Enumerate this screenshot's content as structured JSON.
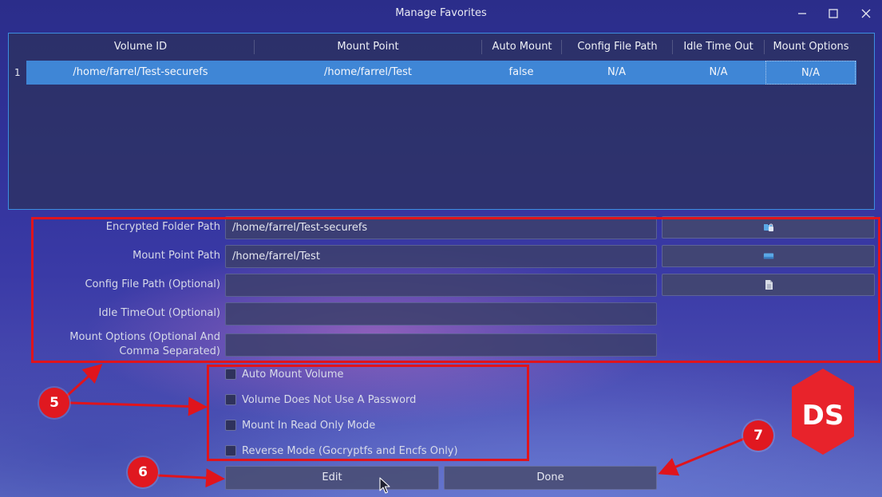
{
  "window": {
    "title": "Manage Favorites"
  },
  "table": {
    "headers": [
      "Volume ID",
      "Mount Point",
      "Auto Mount",
      "Config File Path",
      "Idle Time Out",
      "Mount Options"
    ],
    "rows": [
      {
        "num": "1",
        "cells": [
          "/home/farrel/Test-securefs",
          "/home/farrel/Test",
          "false",
          "N/A",
          "N/A",
          "N/A"
        ]
      }
    ]
  },
  "form": {
    "fields": [
      {
        "label": "Encrypted Folder Path",
        "value": "/home/farrel/Test-securefs",
        "button_icon": "folder-lock-icon"
      },
      {
        "label": "Mount Point Path",
        "value": "/home/farrel/Test",
        "button_icon": "drive-icon"
      },
      {
        "label": "Config File Path (Optional)",
        "value": "",
        "button_icon": "file-icon"
      },
      {
        "label": "Idle TimeOut (Optional)",
        "value": ""
      },
      {
        "label": "Mount Options (Optional And Comma Separated)",
        "value": ""
      }
    ],
    "checkboxes": [
      {
        "label": "Auto Mount Volume",
        "checked": false
      },
      {
        "label": "Volume Does Not Use A Password",
        "checked": false
      },
      {
        "label": "Mount In Read Only Mode",
        "checked": false
      },
      {
        "label": "Reverse Mode (Gocryptfs and Encfs Only)",
        "checked": false
      }
    ]
  },
  "buttons": {
    "edit": "Edit",
    "done": "Done"
  },
  "annotations": {
    "badge_5": "5",
    "badge_6": "6",
    "badge_7": "7",
    "color": "#e0141c"
  },
  "logo": {
    "text": "DS",
    "color": "#e8232b"
  }
}
